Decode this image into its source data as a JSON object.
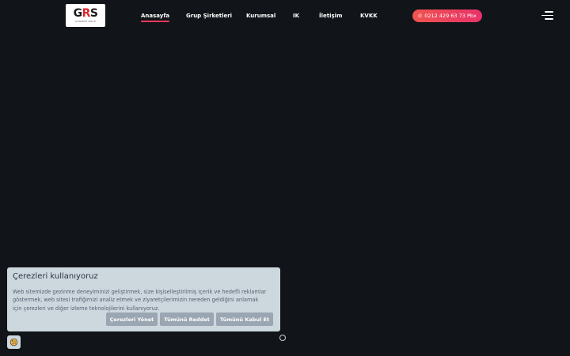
{
  "header": {
    "logo": {
      "mark_g": "G",
      "mark_r": "R",
      "mark_s": "S",
      "subtitle": "GÜRMEN GRUP"
    },
    "nav": [
      {
        "label": "Anasayfa",
        "active": true
      },
      {
        "label": "Grup Şirketleri",
        "active": false
      },
      {
        "label": "Kurumsal",
        "active": false
      },
      {
        "label": "IK",
        "active": false
      },
      {
        "label": "İletişim",
        "active": false
      },
      {
        "label": "KVKK",
        "active": false
      }
    ],
    "phone": {
      "label": "0212 429 63 73 Pbx",
      "icon": "phone-icon"
    },
    "menu_icon": "hamburger-menu-icon"
  },
  "cookie_banner": {
    "title": "Çerezleri kullanıyoruz",
    "text": "Web sitemizde gezinme deneyiminizi geliştirmek, size kişiselleştirilmiş içerik ve hedefli reklamlar göstermek, web sitesi trafiğimizi analiz etmek ve ziyaretçilerimizin nereden geldiğini anlamak için çerezleri ve diğer izleme teknolojilerini kullanıyoruz.",
    "buttons": {
      "manage": "Çerezleri Yönet",
      "reject": "Tümünü Reddet",
      "accept": "Tümünü Kabul Et"
    },
    "settings_icon": "cookie-icon"
  },
  "slider": {
    "dot_icon": "slider-dot"
  },
  "colors": {
    "background": "#111418",
    "accent": "#ee3a5b",
    "phone_gradient_start": "#f0544f",
    "phone_gradient_end": "#e8326a",
    "banner_bg": "#cdd7de",
    "banner_button": "#9aa6b1"
  }
}
